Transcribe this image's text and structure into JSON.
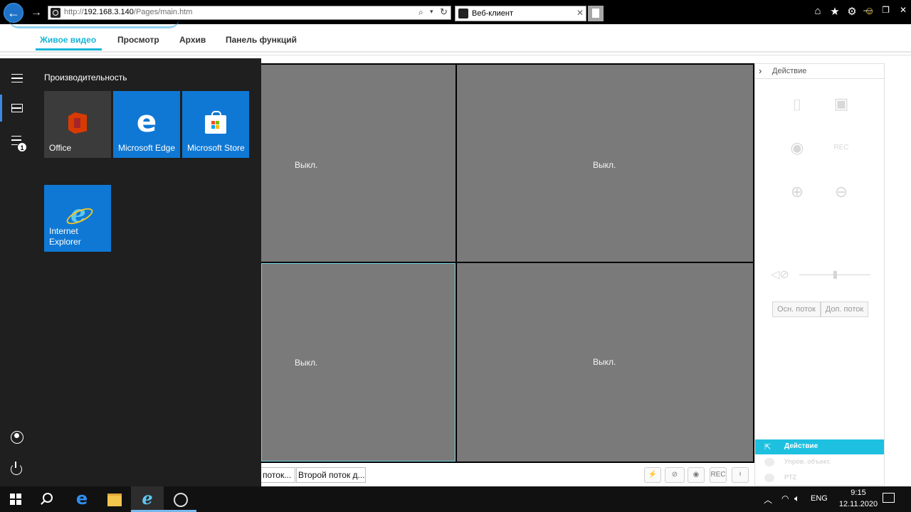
{
  "browser": {
    "url_prefix": "http://",
    "url_host": "192.168.3.140",
    "url_path": "/Pages/main.htm",
    "tab_title": "Веб-клиент"
  },
  "app": {
    "nav_tabs": [
      "Живое видео",
      "Просмотр",
      "Архив",
      "Панель функций"
    ],
    "active_tab": "Живое видео"
  },
  "video_grid": {
    "cells": [
      "Выкл.",
      "Выкл.",
      "Выкл.",
      "Выкл."
    ]
  },
  "stream_bar": {
    "main_stream": "поток...",
    "second_stream": "Второй поток д...",
    "controls": [
      "snapshot-icon",
      "camera-off-icon",
      "record-icon",
      "rec-icon",
      "mic-icon"
    ]
  },
  "right_panel": {
    "title": "Действие",
    "btn_main_stream": "Осн. поток",
    "btn_extra_stream": "Доп. поток",
    "rec_label": "REC",
    "menu": [
      {
        "label": "Действие",
        "active": true
      },
      {
        "label": "Упров. объект.",
        "active": false
      },
      {
        "label": "PTZ",
        "active": false
      }
    ]
  },
  "start_menu": {
    "group_title": "Производительность",
    "badge_count": "1",
    "tiles": [
      {
        "label": "Office",
        "color": "#3b3b3b"
      },
      {
        "label": "Microsoft Edge",
        "color": "#0f78d4"
      },
      {
        "label": "Microsoft Store",
        "color": "#0f78d4"
      },
      {
        "label": "Internet Explorer",
        "color": "#0f78d4"
      }
    ]
  },
  "taskbar": {
    "lang": "ENG",
    "time": "9:15",
    "date": "12.11.2020"
  },
  "colors": {
    "accent": "#18b5d8",
    "action_bar": "#1ec0e0",
    "video_cell": "#7a7a7a",
    "start_bg": "#1f1f1f",
    "tile_blue": "#0f78d4"
  }
}
